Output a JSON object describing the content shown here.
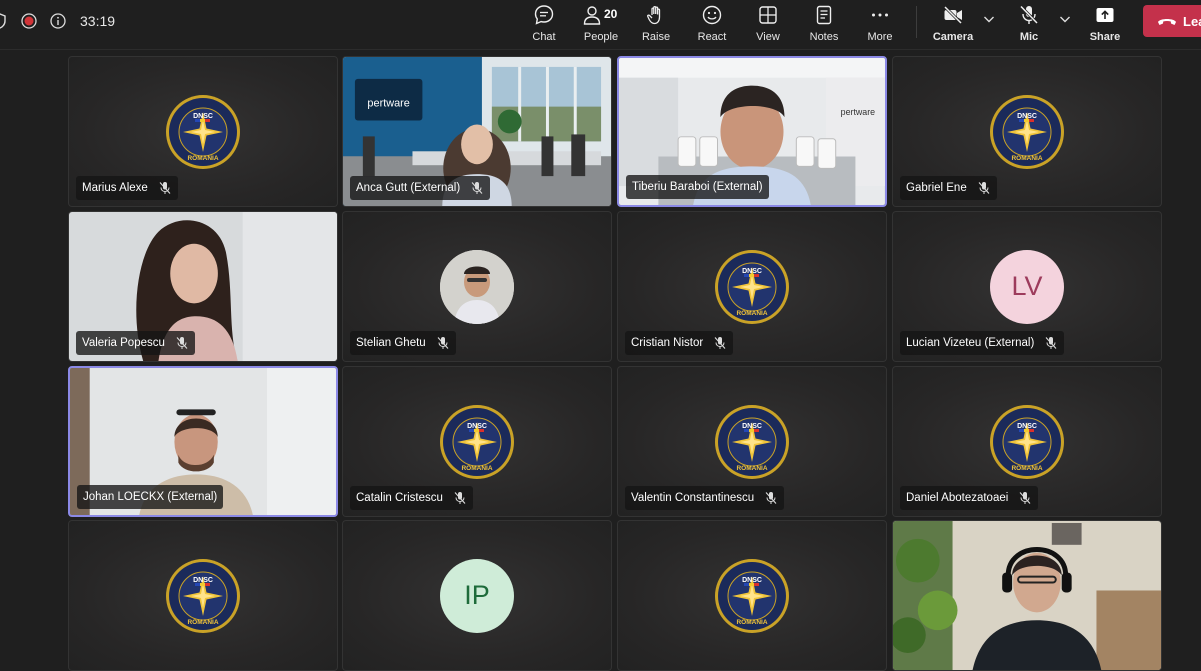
{
  "meeting": {
    "timer": "33:19"
  },
  "toolbar": {
    "chat": "Chat",
    "people": "People",
    "people_count": "20",
    "raise": "Raise",
    "react": "React",
    "view": "View",
    "notes": "Notes",
    "more": "More",
    "camera": "Camera",
    "mic": "Mic",
    "share": "Share",
    "leave": "Lea"
  },
  "participants": [
    {
      "name": "Marius Alexe",
      "type": "logo"
    },
    {
      "name": "Anca Gutt (External)",
      "type": "video"
    },
    {
      "name": "Tiberiu Baraboi (External)",
      "type": "video",
      "speaking": true
    },
    {
      "name": "Gabriel Ene",
      "type": "logo"
    },
    {
      "name": "Valeria Popescu",
      "type": "video"
    },
    {
      "name": "Stelian Ghetu",
      "type": "photo-avatar"
    },
    {
      "name": "Cristian Nistor",
      "type": "logo"
    },
    {
      "name": "Lucian Vizeteu (External)",
      "type": "initials",
      "initials": "LV"
    },
    {
      "name": "Johan LOECKX (External)",
      "type": "video",
      "speaking": true
    },
    {
      "name": "Catalin Cristescu",
      "type": "logo"
    },
    {
      "name": "Valentin Constantinescu",
      "type": "logo"
    },
    {
      "name": "Daniel Abotezatoaei",
      "type": "logo"
    },
    {
      "name": "",
      "type": "logo"
    },
    {
      "name": "",
      "type": "initials",
      "initials": "IP"
    },
    {
      "name": "",
      "type": "logo"
    },
    {
      "name": "",
      "type": "video"
    }
  ],
  "branding": {
    "logo_top": "DNSC",
    "logo_bottom": "ROMANIA",
    "room_brand": "pertware"
  },
  "colors": {
    "leave_red": "#c4314b",
    "speaking_border": "#8b89e6",
    "rec_red": "#d13438"
  }
}
